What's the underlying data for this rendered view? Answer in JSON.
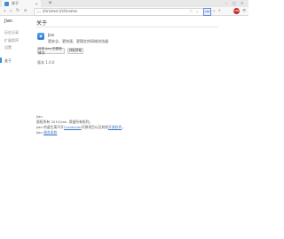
{
  "tab": {
    "title": "关于",
    "close": "×",
    "new_tab": "+"
  },
  "window_controls": {
    "minimize": "–",
    "maximize": "□",
    "close": "×"
  },
  "toolbar": {
    "back": "‹",
    "forward": "›",
    "reload": "↻",
    "home": "⌂",
    "url": "chrome://chrome",
    "extension_badge": "ABP",
    "abp_badge": "ABP",
    "menu": "≡"
  },
  "sidebar": {
    "title": "Jian",
    "items": [
      {
        "label": "历史记录",
        "active": false
      },
      {
        "label": "扩展程序",
        "active": false
      },
      {
        "label": "设置",
        "active": false
      },
      {
        "label": "关于",
        "active": true
      }
    ]
  },
  "main": {
    "title": "关于",
    "app_name": "Jian",
    "tagline": "更安全、更快速、更稳定的网络浏览器",
    "button_check": "检查 Jian 的更新情况",
    "button_help": "获取帮助",
    "version": "版本 1.0.0"
  },
  "footer": {
    "line1": "Jian",
    "line2": "版权所有 2014 Jian. 保留所有权利。",
    "line3_prefix": "Jian 的诞生离不开",
    "line3_link1": "Chromium",
    "line3_mid": "开源项目以及其他",
    "line3_link2": "开源软件",
    "line3_suffix": "。",
    "line4_prefix": "Jian",
    "line4_link": "服务条款"
  },
  "colors": {
    "accent": "#3b8fd6",
    "link": "#3b74c4",
    "abp": "#c62828"
  }
}
